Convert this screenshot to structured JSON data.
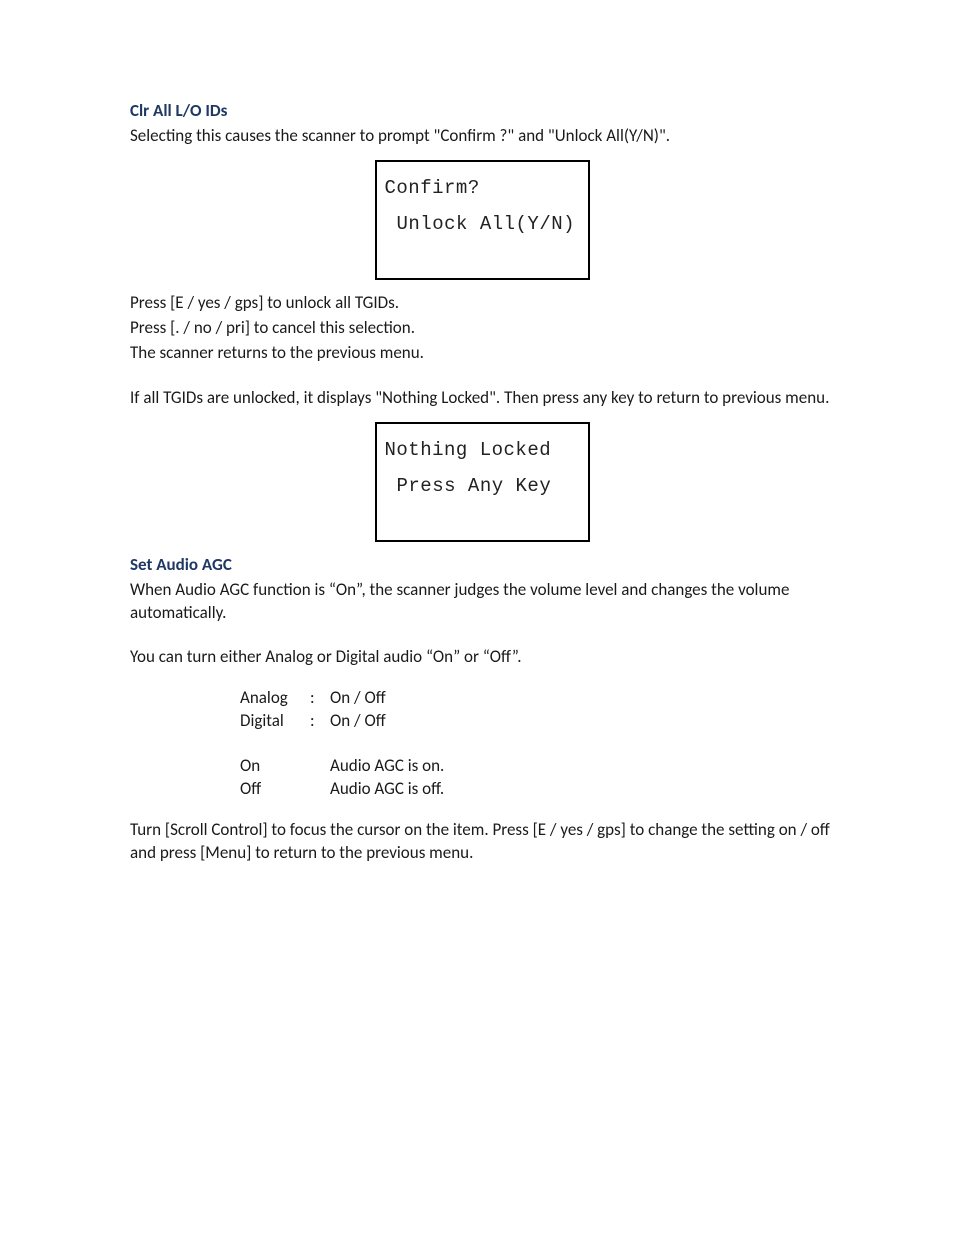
{
  "section1": {
    "title": "Clr All L/O IDs",
    "intro": "Selecting this causes the scanner to prompt \"Confirm ?\" and \"Unlock All(Y/N)\".",
    "lcd1_line1": "Confirm?",
    "lcd1_line2": "Unlock All(Y/N)",
    "after1_l1": "Press [E / yes / gps] to unlock all TGIDs.",
    "after1_l2": "Press [. / no / pri] to cancel this selection.",
    "after1_l3": "The scanner returns to the previous menu.",
    "after1_p2": "If all TGIDs are unlocked, it displays \"Nothing Locked\". Then press any key to return to previous menu.",
    "lcd2_line1": "Nothing Locked",
    "lcd2_line2": "Press Any Key"
  },
  "section2": {
    "title": "Set Audio AGC",
    "intro": "When Audio AGC function is “On”, the scanner judges the volume level and changes the volume automatically.",
    "p2": "You can turn either Analog or Digital audio “On” or “Off”.",
    "rows": {
      "analog_label": "Analog",
      "analog_colon": ":",
      "analog_value": "On / Off",
      "digital_label": "Digital",
      "digital_colon": ":",
      "digital_value": "On / Off",
      "on_label": "On",
      "on_value": "Audio AGC is on.",
      "off_label": "Off",
      "off_value": "Audio AGC is off."
    },
    "footer": "Turn [Scroll Control] to focus the cursor on the item. Press [E / yes / gps] to change the setting on / off and press [Menu] to return to the previous menu."
  }
}
